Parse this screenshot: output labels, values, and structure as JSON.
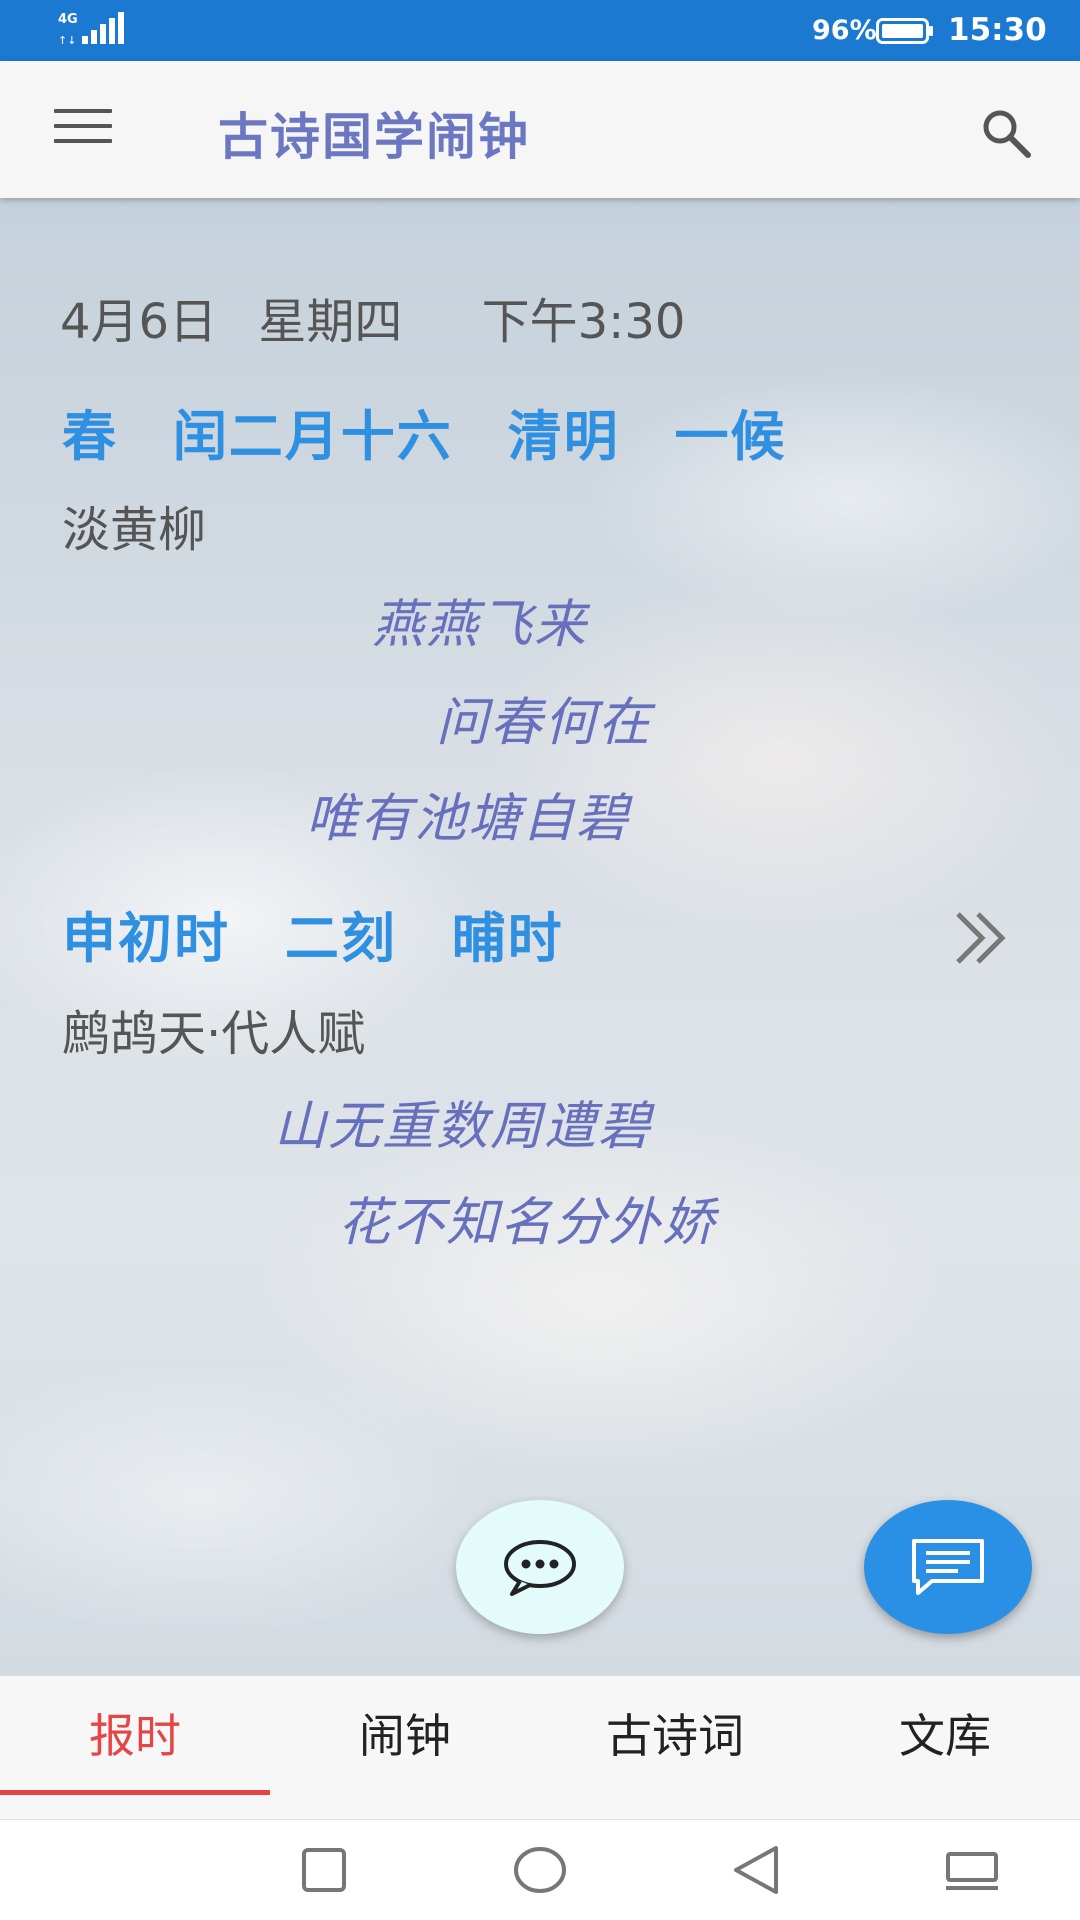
{
  "status_bar": {
    "network": "4G",
    "battery": "96%",
    "time": "15:30"
  },
  "app_bar": {
    "title": "古诗国学闹钟"
  },
  "date": {
    "day": "4月6日",
    "weekday": "星期四",
    "time": "下午3:30"
  },
  "lunar": {
    "season": "春",
    "lunar_date": "闰二月十六",
    "solar_term": "清明",
    "pentad": "一候"
  },
  "phenology": {
    "title": "淡黄柳",
    "lines": [
      "燕燕飞来",
      "问春何在",
      "唯有池塘自碧"
    ]
  },
  "hour": {
    "shichen": "申初时",
    "ke": "二刻",
    "name": "晡时"
  },
  "hour_poem": {
    "title": "鹧鸪天·代人赋",
    "lines": [
      "山无重数周遭碧",
      "花不知名分外娇"
    ]
  },
  "tabs": [
    {
      "label": "报时",
      "active": true
    },
    {
      "label": "闹钟",
      "active": false
    },
    {
      "label": "古诗词",
      "active": false
    },
    {
      "label": "文库",
      "active": false
    }
  ],
  "colors": {
    "status_bar": "#1c79d2",
    "accent_blue": "#2f8fe0",
    "poem_purple": "#6670bd",
    "tab_active": "#e54545"
  },
  "icons": {
    "menu": "hamburger-icon",
    "search": "search-icon",
    "more": "double-chevron-right-icon",
    "chat": "chat-bubble-icon",
    "message": "message-icon"
  }
}
